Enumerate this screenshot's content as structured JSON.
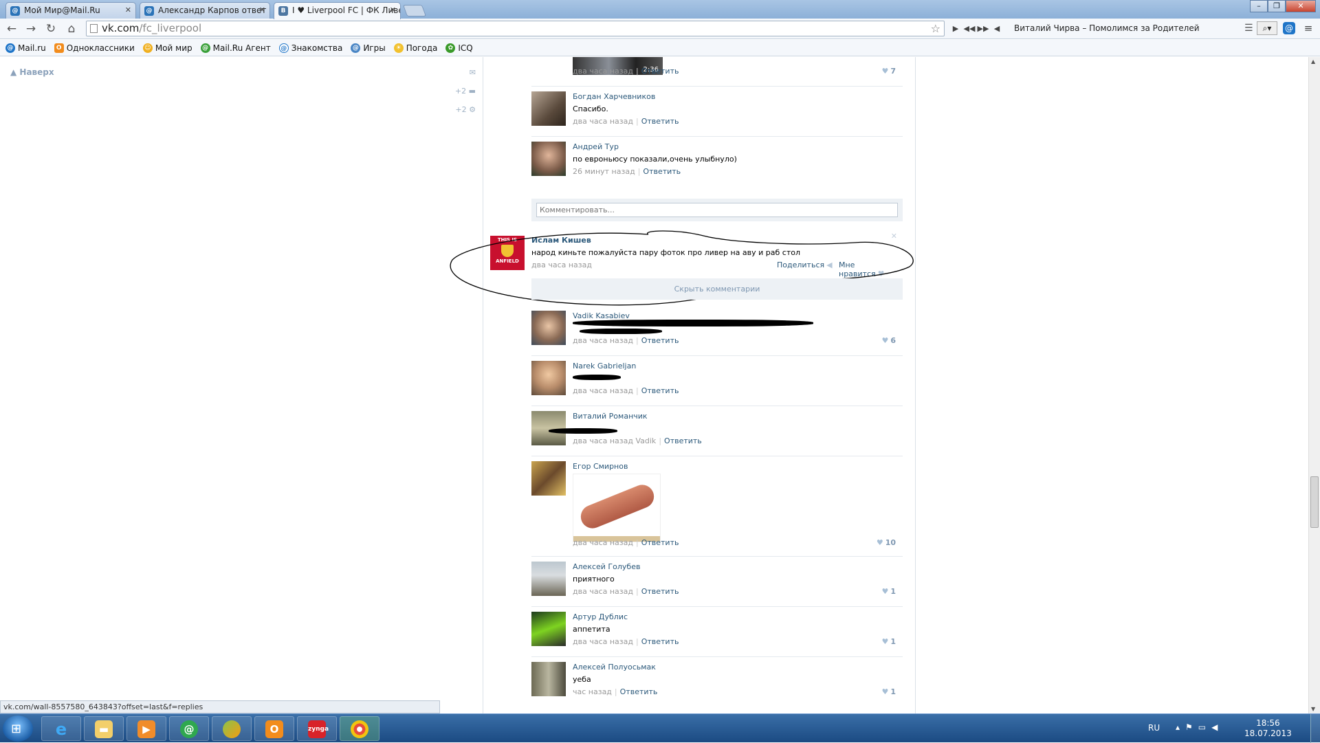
{
  "browser": {
    "tabs": [
      {
        "label": "Мой Мир@Mail.Ru",
        "icon": "mailru-icon"
      },
      {
        "label": "Александр Карпов ответ",
        "icon": "mailru-icon"
      },
      {
        "label": "I ♥ Liverpool FC | ФК Ливе",
        "icon": "vk-icon"
      }
    ],
    "url_host": "vk.com",
    "url_path": "/fc_liverpool",
    "player": {
      "track": "Виталий Чирва – Помолимся за Родителей"
    },
    "bookmarks": [
      "Mail.ru",
      "Одноклассники",
      "Мой мир",
      "Mail.Ru Агент",
      "Знакомства",
      "Игры",
      "Погода",
      "ICQ"
    ]
  },
  "page": {
    "back_to_top": "Наверх",
    "side_counts": [
      "+2",
      "+2"
    ],
    "video_duration": "2:36",
    "top_replies": [
      {
        "author": "",
        "text": "",
        "date": "два часа назад",
        "reply": "Ответить",
        "likes": "7"
      },
      {
        "author": "Богдан Харчевников",
        "text": "Спасибо.",
        "date": "два часа назад",
        "reply": "Ответить",
        "likes": ""
      },
      {
        "author": "Андрей Тур",
        "text": "по евроньюсу показали,очень улыбнуло)",
        "date": "26 минут назад",
        "reply": "Ответить",
        "likes": ""
      }
    ],
    "comment_placeholder": "Комментировать...",
    "post": {
      "author": "Ислам Кишев",
      "text": "народ киньте пожалуйста пару фоток про ливер на аву и раб стол",
      "date": "два часа назад",
      "share": "Поделиться",
      "like": "Мне нравится",
      "avatar_top": "THIS IS",
      "avatar_bottom": "ANFIELD"
    },
    "hide_comments": "Скрыть комментарии",
    "replies": [
      {
        "author": "Vadik Kasabiev",
        "text": "",
        "date": "два часа назад",
        "reply": "Ответить",
        "likes": "6"
      },
      {
        "author": "Narek Gabrieljan",
        "text": "",
        "date": "два часа назад",
        "reply": "Ответить",
        "likes": ""
      },
      {
        "author": "Виталий Романчик",
        "text": "",
        "date": "два часа назад",
        "to": "Vadik",
        "reply": "Ответить",
        "likes": ""
      },
      {
        "author": "Егор Смирнов",
        "text": "",
        "date": "два часа назад",
        "reply": "Ответить",
        "likes": "10"
      },
      {
        "author": "Алексей Голубев",
        "text": "приятного",
        "date": "два часа назад",
        "reply": "Ответить",
        "likes": "1"
      },
      {
        "author": "Артур Дублис",
        "text": "аппетита",
        "date": "два часа назад",
        "reply": "Ответить",
        "likes": "1"
      },
      {
        "author": "Алексей Полуосьмак",
        "text": "уеба",
        "date": "час назад",
        "reply": "Ответить",
        "likes": "1"
      }
    ],
    "status_url": "vk.com/wall-8557580_643843?offset=last&f=replies"
  },
  "taskbar": {
    "lang": "RU",
    "time": "18:56",
    "date": "18.07.2013"
  }
}
